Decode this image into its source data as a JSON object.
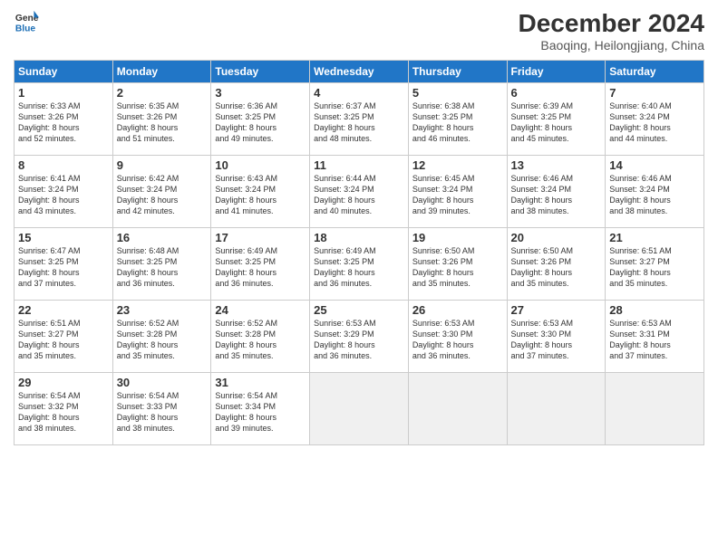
{
  "header": {
    "logo_line1": "General",
    "logo_line2": "Blue",
    "month": "December 2024",
    "location": "Baoqing, Heilongjiang, China"
  },
  "days_of_week": [
    "Sunday",
    "Monday",
    "Tuesday",
    "Wednesday",
    "Thursday",
    "Friday",
    "Saturday"
  ],
  "weeks": [
    [
      {
        "day": 1,
        "sunrise": "6:33 AM",
        "sunset": "3:26 PM",
        "daylight": "8 hours and 52 minutes."
      },
      {
        "day": 2,
        "sunrise": "6:35 AM",
        "sunset": "3:26 PM",
        "daylight": "8 hours and 51 minutes."
      },
      {
        "day": 3,
        "sunrise": "6:36 AM",
        "sunset": "3:25 PM",
        "daylight": "8 hours and 49 minutes."
      },
      {
        "day": 4,
        "sunrise": "6:37 AM",
        "sunset": "3:25 PM",
        "daylight": "8 hours and 48 minutes."
      },
      {
        "day": 5,
        "sunrise": "6:38 AM",
        "sunset": "3:25 PM",
        "daylight": "8 hours and 46 minutes."
      },
      {
        "day": 6,
        "sunrise": "6:39 AM",
        "sunset": "3:25 PM",
        "daylight": "8 hours and 45 minutes."
      },
      {
        "day": 7,
        "sunrise": "6:40 AM",
        "sunset": "3:24 PM",
        "daylight": "8 hours and 44 minutes."
      }
    ],
    [
      {
        "day": 8,
        "sunrise": "6:41 AM",
        "sunset": "3:24 PM",
        "daylight": "8 hours and 43 minutes."
      },
      {
        "day": 9,
        "sunrise": "6:42 AM",
        "sunset": "3:24 PM",
        "daylight": "8 hours and 42 minutes."
      },
      {
        "day": 10,
        "sunrise": "6:43 AM",
        "sunset": "3:24 PM",
        "daylight": "8 hours and 41 minutes."
      },
      {
        "day": 11,
        "sunrise": "6:44 AM",
        "sunset": "3:24 PM",
        "daylight": "8 hours and 40 minutes."
      },
      {
        "day": 12,
        "sunrise": "6:45 AM",
        "sunset": "3:24 PM",
        "daylight": "8 hours and 39 minutes."
      },
      {
        "day": 13,
        "sunrise": "6:46 AM",
        "sunset": "3:24 PM",
        "daylight": "8 hours and 38 minutes."
      },
      {
        "day": 14,
        "sunrise": "6:46 AM",
        "sunset": "3:24 PM",
        "daylight": "8 hours and 38 minutes."
      }
    ],
    [
      {
        "day": 15,
        "sunrise": "6:47 AM",
        "sunset": "3:25 PM",
        "daylight": "8 hours and 37 minutes."
      },
      {
        "day": 16,
        "sunrise": "6:48 AM",
        "sunset": "3:25 PM",
        "daylight": "8 hours and 36 minutes."
      },
      {
        "day": 17,
        "sunrise": "6:49 AM",
        "sunset": "3:25 PM",
        "daylight": "8 hours and 36 minutes."
      },
      {
        "day": 18,
        "sunrise": "6:49 AM",
        "sunset": "3:25 PM",
        "daylight": "8 hours and 36 minutes."
      },
      {
        "day": 19,
        "sunrise": "6:50 AM",
        "sunset": "3:26 PM",
        "daylight": "8 hours and 35 minutes."
      },
      {
        "day": 20,
        "sunrise": "6:50 AM",
        "sunset": "3:26 PM",
        "daylight": "8 hours and 35 minutes."
      },
      {
        "day": 21,
        "sunrise": "6:51 AM",
        "sunset": "3:27 PM",
        "daylight": "8 hours and 35 minutes."
      }
    ],
    [
      {
        "day": 22,
        "sunrise": "6:51 AM",
        "sunset": "3:27 PM",
        "daylight": "8 hours and 35 minutes."
      },
      {
        "day": 23,
        "sunrise": "6:52 AM",
        "sunset": "3:28 PM",
        "daylight": "8 hours and 35 minutes."
      },
      {
        "day": 24,
        "sunrise": "6:52 AM",
        "sunset": "3:28 PM",
        "daylight": "8 hours and 35 minutes."
      },
      {
        "day": 25,
        "sunrise": "6:53 AM",
        "sunset": "3:29 PM",
        "daylight": "8 hours and 36 minutes."
      },
      {
        "day": 26,
        "sunrise": "6:53 AM",
        "sunset": "3:30 PM",
        "daylight": "8 hours and 36 minutes."
      },
      {
        "day": 27,
        "sunrise": "6:53 AM",
        "sunset": "3:30 PM",
        "daylight": "8 hours and 37 minutes."
      },
      {
        "day": 28,
        "sunrise": "6:53 AM",
        "sunset": "3:31 PM",
        "daylight": "8 hours and 37 minutes."
      }
    ],
    [
      {
        "day": 29,
        "sunrise": "6:54 AM",
        "sunset": "3:32 PM",
        "daylight": "8 hours and 38 minutes."
      },
      {
        "day": 30,
        "sunrise": "6:54 AM",
        "sunset": "3:33 PM",
        "daylight": "8 hours and 38 minutes."
      },
      {
        "day": 31,
        "sunrise": "6:54 AM",
        "sunset": "3:34 PM",
        "daylight": "8 hours and 39 minutes."
      },
      null,
      null,
      null,
      null
    ]
  ]
}
